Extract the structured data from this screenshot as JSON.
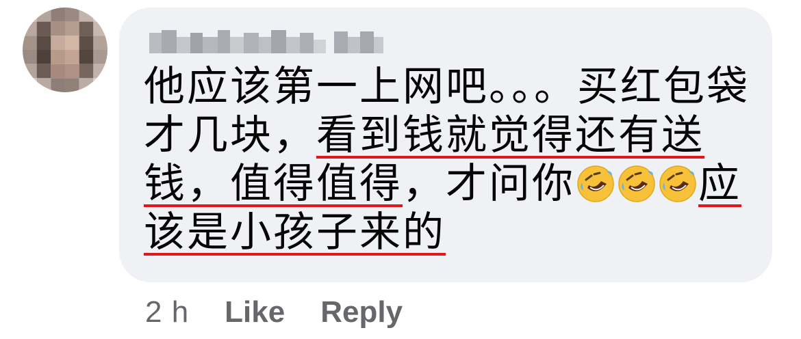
{
  "comment": {
    "author_name": "",
    "text_segments": [
      {
        "text": "他应该第一上网吧。。。买红包袋才几块，",
        "highlight": false
      },
      {
        "text": "看到钱就觉得还有送钱，值得值得",
        "highlight": true
      },
      {
        "text": "，才问你",
        "highlight": false
      },
      {
        "emoji": "rolling-on-floor-laughing-emoji",
        "count": 3
      },
      {
        "text": "应该是小孩子来的",
        "highlight": true
      }
    ],
    "timestamp": "2 h",
    "like_label": "Like",
    "reply_label": "Reply"
  },
  "colors": {
    "bubble_bg": "#eff1f4",
    "text": "#050505",
    "meta_text": "#65676b",
    "highlight_underline": "#e0161c"
  }
}
